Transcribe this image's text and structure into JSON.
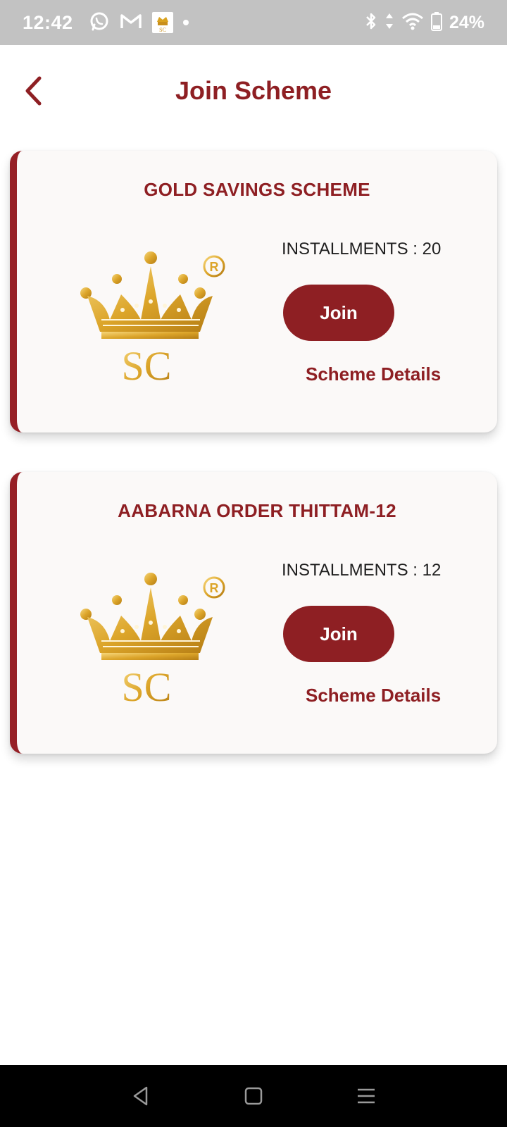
{
  "status_bar": {
    "time": "12:42",
    "battery": "24%",
    "icons_left": [
      "whatsapp-icon",
      "gmail-icon",
      "app-thumbnail-icon",
      "notification-dot-icon"
    ],
    "icons_right": [
      "bluetooth-icon",
      "data-arrows-icon",
      "wifi-icon",
      "battery-icon"
    ]
  },
  "header": {
    "title": "Join Scheme",
    "back_icon": "chevron-left-icon"
  },
  "schemes": [
    {
      "title": "GOLD SAVINGS SCHEME",
      "installments": "INSTALLMENTS : 20",
      "join_label": "Join",
      "details_label": "Scheme Details",
      "logo_text": "SC"
    },
    {
      "title": "AABARNA ORDER THITTAM-12",
      "installments": "INSTALLMENTS : 12",
      "join_label": "Join",
      "details_label": "Scheme Details",
      "logo_text": "SC"
    }
  ],
  "nav_bar": {
    "buttons": [
      "back-triangle-icon",
      "home-square-icon",
      "menu-lines-icon"
    ]
  },
  "colors": {
    "accent": "#8e1f23",
    "card_bg": "#fbf9f8",
    "gold": "#d9a21f",
    "status_bar_bg": "#c2c2c2"
  }
}
